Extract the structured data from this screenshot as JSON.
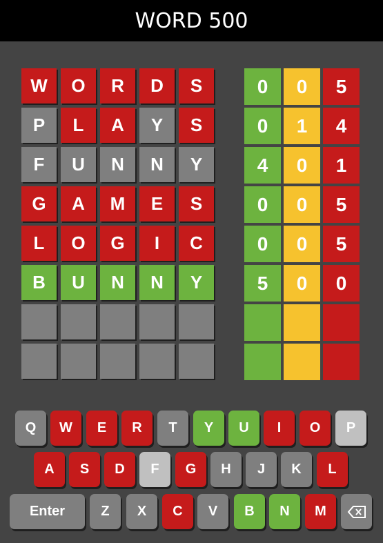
{
  "header": {
    "title": "WORD 500"
  },
  "colors": {
    "green": "#6db33f",
    "yellow": "#f6c22e",
    "red": "#c51b1b",
    "gray": "#7f7f7f",
    "lightgray": "#c0c0c0",
    "bg": "#444444"
  },
  "board": {
    "rows": [
      {
        "letters": [
          "W",
          "O",
          "R",
          "D",
          "S"
        ],
        "states": [
          "red",
          "red",
          "red",
          "red",
          "red"
        ],
        "scores": [
          "0",
          "0",
          "5"
        ]
      },
      {
        "letters": [
          "P",
          "L",
          "A",
          "Y",
          "S"
        ],
        "states": [
          "gray",
          "red",
          "red",
          "gray",
          "red"
        ],
        "scores": [
          "0",
          "1",
          "4"
        ]
      },
      {
        "letters": [
          "F",
          "U",
          "N",
          "N",
          "Y"
        ],
        "states": [
          "gray",
          "gray",
          "gray",
          "gray",
          "gray"
        ],
        "scores": [
          "4",
          "0",
          "1"
        ]
      },
      {
        "letters": [
          "G",
          "A",
          "M",
          "E",
          "S"
        ],
        "states": [
          "red",
          "red",
          "red",
          "red",
          "red"
        ],
        "scores": [
          "0",
          "0",
          "5"
        ]
      },
      {
        "letters": [
          "L",
          "O",
          "G",
          "I",
          "C"
        ],
        "states": [
          "red",
          "red",
          "red",
          "red",
          "red"
        ],
        "scores": [
          "0",
          "0",
          "5"
        ]
      },
      {
        "letters": [
          "B",
          "U",
          "N",
          "N",
          "Y"
        ],
        "states": [
          "green",
          "green",
          "green",
          "green",
          "green"
        ],
        "scores": [
          "5",
          "0",
          "0"
        ]
      },
      {
        "letters": [
          "",
          "",
          "",
          "",
          ""
        ],
        "states": [
          "gray",
          "gray",
          "gray",
          "gray",
          "gray"
        ],
        "scores": [
          "",
          "",
          ""
        ]
      },
      {
        "letters": [
          "",
          "",
          "",
          "",
          ""
        ],
        "states": [
          "gray",
          "gray",
          "gray",
          "gray",
          "gray"
        ],
        "scores": [
          "",
          "",
          ""
        ]
      }
    ]
  },
  "keyboard": {
    "rows": [
      [
        {
          "k": "Q",
          "s": "gray"
        },
        {
          "k": "W",
          "s": "red"
        },
        {
          "k": "E",
          "s": "red"
        },
        {
          "k": "R",
          "s": "red"
        },
        {
          "k": "T",
          "s": "gray"
        },
        {
          "k": "Y",
          "s": "green"
        },
        {
          "k": "U",
          "s": "green"
        },
        {
          "k": "I",
          "s": "red"
        },
        {
          "k": "O",
          "s": "red"
        },
        {
          "k": "P",
          "s": "lightgray"
        }
      ],
      [
        {
          "k": "A",
          "s": "red"
        },
        {
          "k": "S",
          "s": "red"
        },
        {
          "k": "D",
          "s": "red"
        },
        {
          "k": "F",
          "s": "lightgray"
        },
        {
          "k": "G",
          "s": "red"
        },
        {
          "k": "H",
          "s": "gray"
        },
        {
          "k": "J",
          "s": "gray"
        },
        {
          "k": "K",
          "s": "gray"
        },
        {
          "k": "L",
          "s": "red"
        }
      ],
      [
        {
          "k": "Enter",
          "s": "gray"
        },
        {
          "k": "Z",
          "s": "gray"
        },
        {
          "k": "X",
          "s": "gray"
        },
        {
          "k": "C",
          "s": "red"
        },
        {
          "k": "V",
          "s": "gray"
        },
        {
          "k": "B",
          "s": "green"
        },
        {
          "k": "N",
          "s": "green"
        },
        {
          "k": "M",
          "s": "red"
        },
        {
          "k": "",
          "s": "gray",
          "icon": "backspace-icon"
        }
      ]
    ]
  }
}
